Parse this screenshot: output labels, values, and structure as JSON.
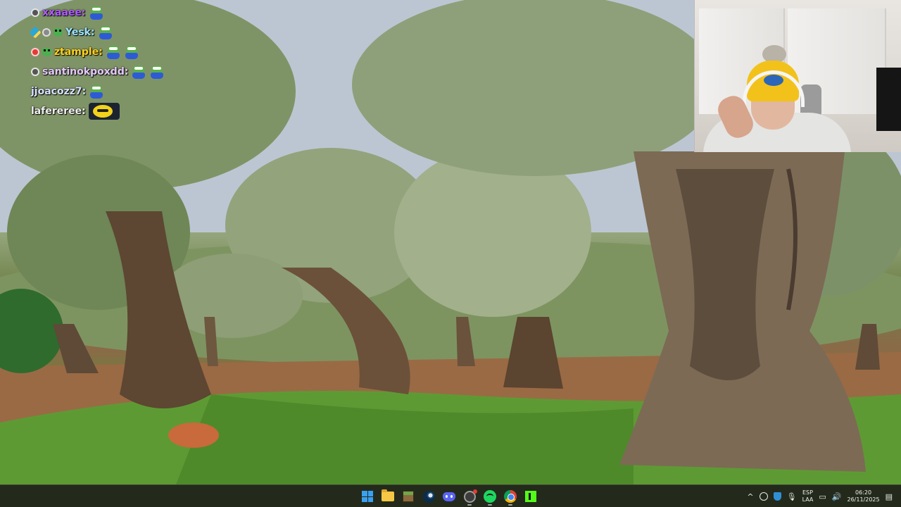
{
  "chat": {
    "messages": [
      {
        "user": "xxaaee:",
        "color": "#b05cff"
      },
      {
        "user": "Yesk:",
        "color": "#9be3ff"
      },
      {
        "user": "ztample:",
        "color": "#ffd21a"
      },
      {
        "user": "santinokpoxdd:",
        "color": "#e6c9ff"
      },
      {
        "user": "jjoacozz7:",
        "color": "#d8e0ff"
      },
      {
        "user": "lafereree:",
        "color": "#f0f0f0"
      }
    ]
  },
  "taskbar": {
    "apps": [
      {
        "name": "start",
        "icon": "windows-logo-icon"
      },
      {
        "name": "file-explorer",
        "icon": "folder-icon"
      },
      {
        "name": "minecraft",
        "icon": "minecraft-block-icon"
      },
      {
        "name": "steam",
        "icon": "steam-icon"
      },
      {
        "name": "discord",
        "icon": "discord-icon"
      },
      {
        "name": "obs",
        "icon": "obs-icon"
      },
      {
        "name": "spotify",
        "icon": "spotify-icon"
      },
      {
        "name": "chrome",
        "icon": "chrome-icon"
      },
      {
        "name": "kick",
        "icon": "kick-icon"
      }
    ],
    "tray": {
      "chevron": "^",
      "language": "ESP",
      "layout": "LAA",
      "time": "06:20",
      "date": "26/11/2025"
    }
  }
}
